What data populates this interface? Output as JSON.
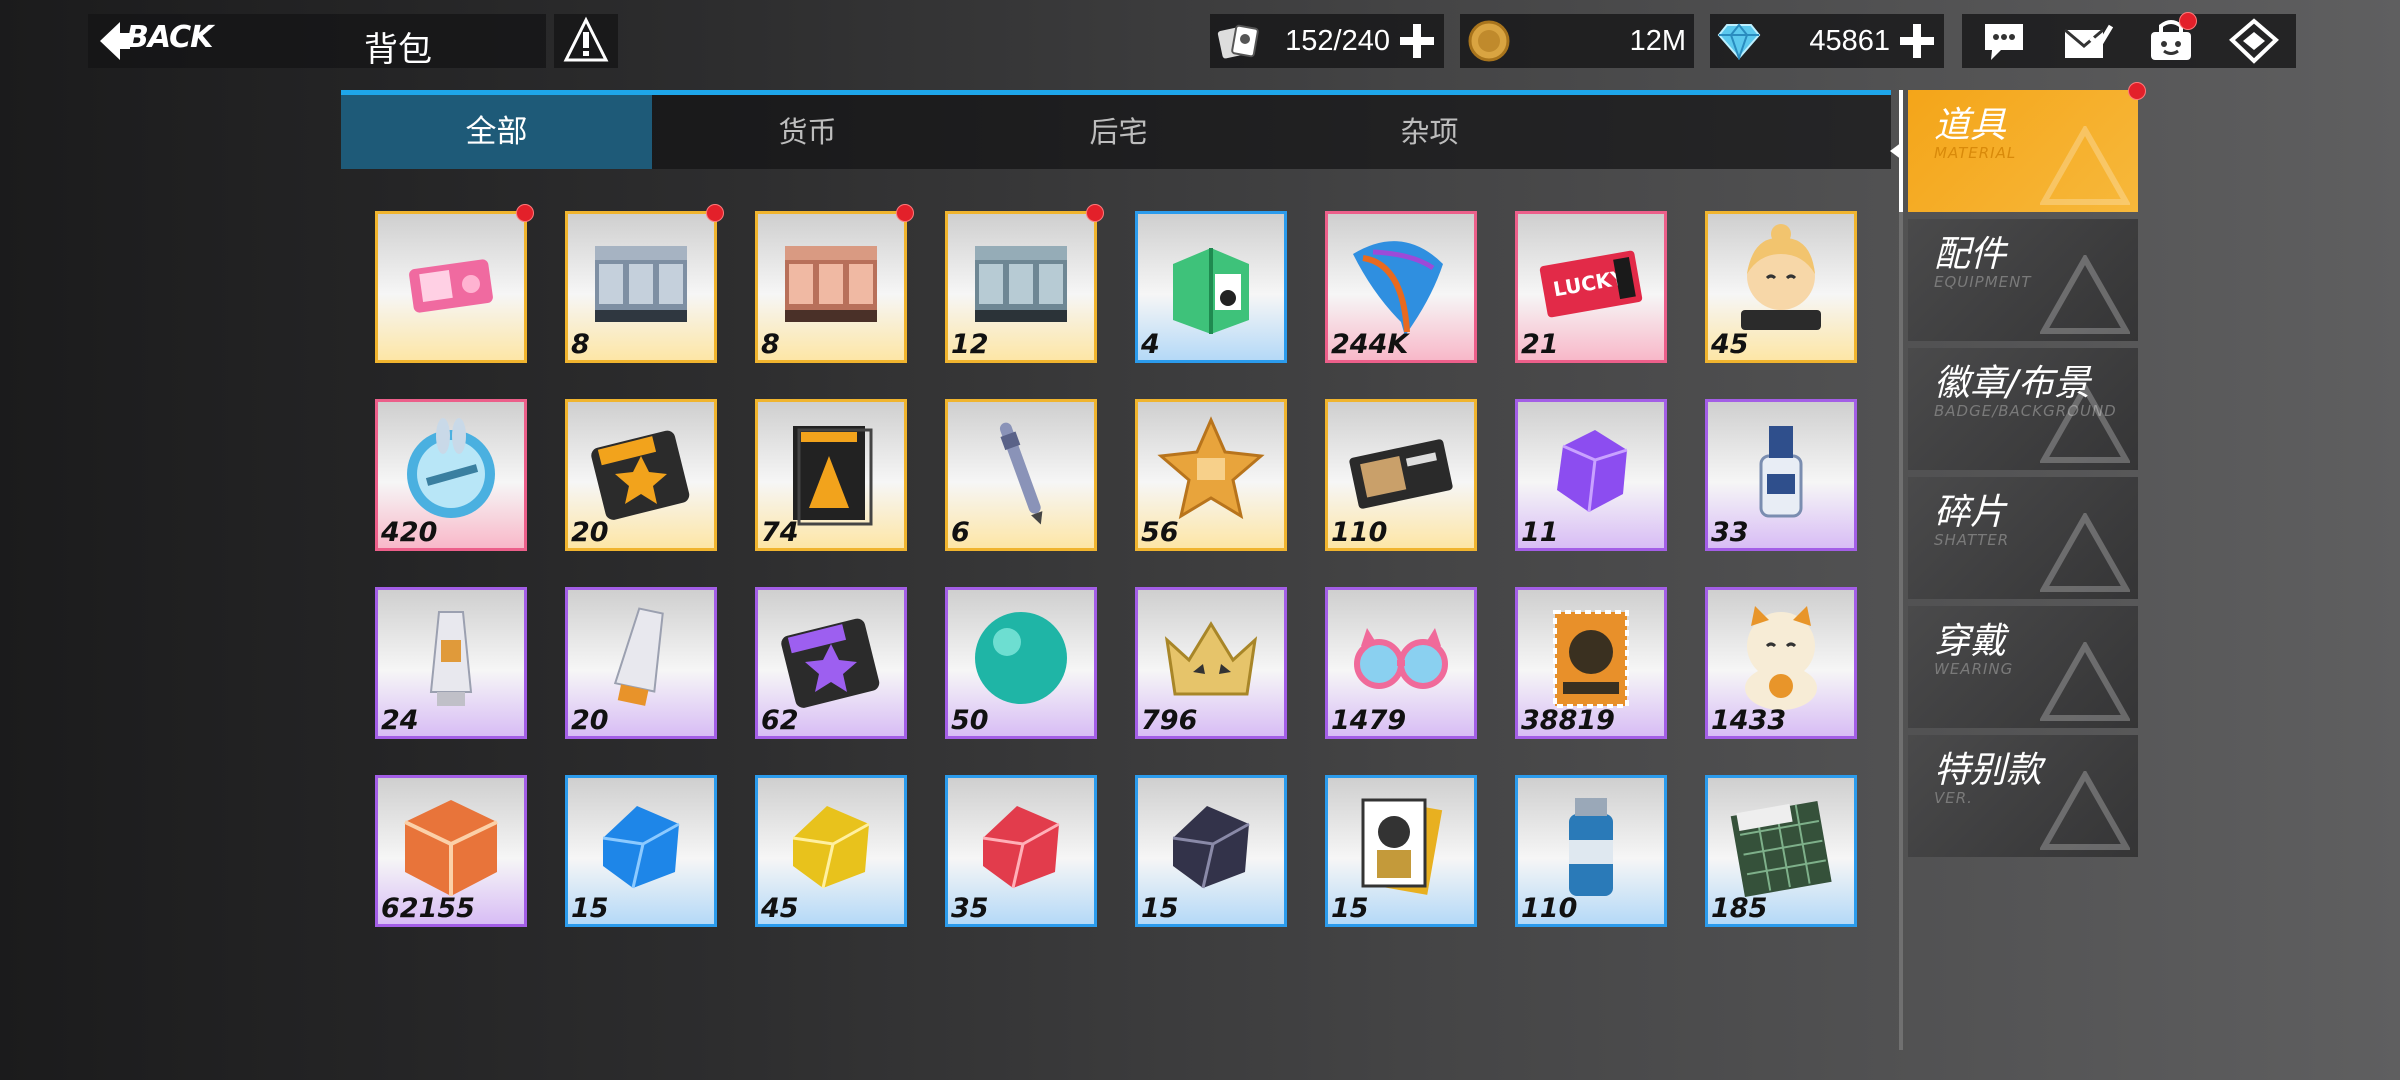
{
  "header": {
    "back_label": "BACK",
    "title": "背包",
    "figure_count": "152/240",
    "coins": "12M",
    "diamonds": "45861"
  },
  "icons": {
    "back": "back-arrow-icon",
    "info": "info-icon",
    "figure": "figure-cards-icon",
    "coin": "coin-icon",
    "diamond": "diamond-icon",
    "chat": "chat-icon",
    "mail": "mail-icon",
    "shop": "shop-icon",
    "home": "home-icon"
  },
  "tabs": [
    "全部",
    "货币",
    "后宅",
    "杂项"
  ],
  "active_tab": "全部",
  "items": [
    {
      "name": "pink-ticket",
      "count": "",
      "rarity": "gold",
      "new": true
    },
    {
      "name": "figure-box-silver",
      "count": "8",
      "rarity": "gold",
      "new": true
    },
    {
      "name": "figure-box-bronze",
      "count": "8",
      "rarity": "gold",
      "new": true
    },
    {
      "name": "figure-box-steel",
      "count": "12",
      "rarity": "gold",
      "new": true
    },
    {
      "name": "green-gift-box",
      "count": "4",
      "rarity": "blue",
      "new": false
    },
    {
      "name": "blue-feather",
      "count": "244K",
      "rarity": "pink",
      "new": false
    },
    {
      "name": "lucky-ticket",
      "count": "21",
      "rarity": "pink",
      "new": false
    },
    {
      "name": "figurestory-mascot",
      "count": "45",
      "rarity": "gold",
      "new": false
    },
    {
      "name": "bunny-orb",
      "count": "420",
      "rarity": "pink",
      "new": false
    },
    {
      "name": "badge-scroll-gold",
      "count": "20",
      "rarity": "gold",
      "new": false
    },
    {
      "name": "strengthen-manual",
      "count": "74",
      "rarity": "gold",
      "new": false
    },
    {
      "name": "pen",
      "count": "6",
      "rarity": "gold",
      "new": false
    },
    {
      "name": "gold-star-badge",
      "count": "56",
      "rarity": "gold",
      "new": false
    },
    {
      "name": "figure-card-pack",
      "count": "110",
      "rarity": "gold",
      "new": false
    },
    {
      "name": "purple-crystal",
      "count": "11",
      "rarity": "purple",
      "new": false
    },
    {
      "name": "paint-bottle",
      "count": "33",
      "rarity": "purple",
      "new": false
    },
    {
      "name": "glue-tube-small",
      "count": "24",
      "rarity": "purple",
      "new": false
    },
    {
      "name": "glue-tube-orange",
      "count": "20",
      "rarity": "purple",
      "new": false
    },
    {
      "name": "badge-scroll-purple",
      "count": "62",
      "rarity": "purple",
      "new": false
    },
    {
      "name": "teal-orb",
      "count": "50",
      "rarity": "purple",
      "new": false
    },
    {
      "name": "gold-crown",
      "count": "796",
      "rarity": "purple",
      "new": false
    },
    {
      "name": "cat-glasses",
      "count": "1479",
      "rarity": "purple",
      "new": false
    },
    {
      "name": "stamp",
      "count": "38819",
      "rarity": "purple",
      "new": false
    },
    {
      "name": "lucky-cat",
      "count": "1433",
      "rarity": "purple",
      "new": false
    },
    {
      "name": "orange-cube",
      "count": "62155",
      "rarity": "purple",
      "new": false
    },
    {
      "name": "blue-gem",
      "count": "15",
      "rarity": "blue",
      "new": false
    },
    {
      "name": "yellow-gem",
      "count": "45",
      "rarity": "blue",
      "new": false
    },
    {
      "name": "red-gem",
      "count": "35",
      "rarity": "blue",
      "new": false
    },
    {
      "name": "dark-gem",
      "count": "15",
      "rarity": "blue",
      "new": false
    },
    {
      "name": "character-cards",
      "count": "15",
      "rarity": "blue",
      "new": false
    },
    {
      "name": "spray-can",
      "count": "110",
      "rarity": "blue",
      "new": false
    },
    {
      "name": "cutting-mat",
      "count": "185",
      "rarity": "blue",
      "new": false
    }
  ],
  "side_menu": [
    {
      "cn": "道具",
      "en": "MATERIAL",
      "active": true,
      "new": true
    },
    {
      "cn": "配件",
      "en": "EQUIPMENT",
      "active": false,
      "new": false
    },
    {
      "cn": "徽章/布景",
      "en": "BADGE/BACKGROUND",
      "active": false,
      "new": false
    },
    {
      "cn": "碎片",
      "en": "SHATTER",
      "active": false,
      "new": false
    },
    {
      "cn": "穿戴",
      "en": "WEARING",
      "active": false,
      "new": false
    },
    {
      "cn": "特别款",
      "en": "VER.",
      "active": false,
      "new": false
    }
  ],
  "colors": {
    "accent": "#1ea6ea",
    "active_tab": "#1e5a78",
    "active_side": "#f4a519",
    "notify": "#e3202a",
    "rarity_gold": "#f0b42e",
    "rarity_pink": "#ec5f8a",
    "rarity_blue": "#2b9bec",
    "rarity_purple": "#a35ee6"
  }
}
